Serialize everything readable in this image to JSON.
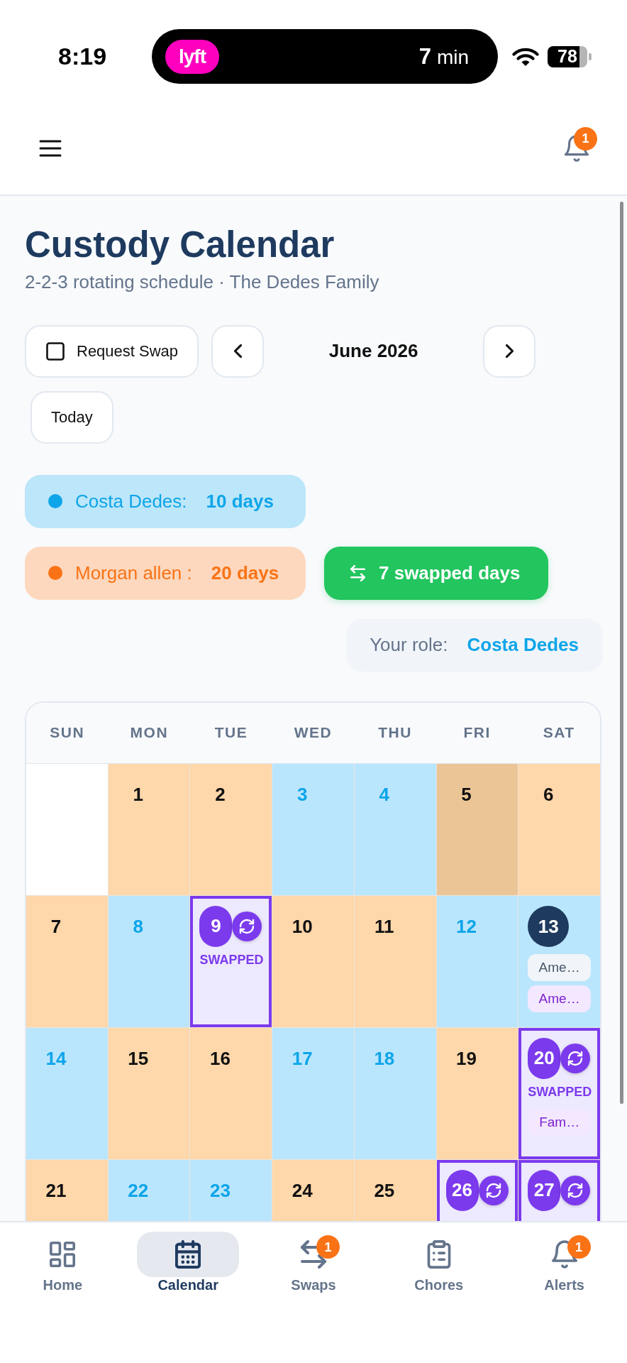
{
  "status_bar": {
    "time": "8:19",
    "live_activity": {
      "logo": "lyft",
      "eta_value": "7",
      "eta_unit": "min"
    },
    "battery": "78"
  },
  "header": {
    "notification_badge": "1"
  },
  "page": {
    "title": "Custody Calendar",
    "subtitle": "2-2-3 rotating schedule · The Dedes Family"
  },
  "toolbar": {
    "request_swap": {
      "label": "Request Swap",
      "checked": false
    },
    "month": "June 2026",
    "today_button": "Today"
  },
  "legend": [
    {
      "kind": "parent",
      "name": "Costa Dedes:",
      "count": "10 days",
      "color": "#0ea5e9"
    },
    {
      "kind": "parent",
      "name": "Morgan allen :",
      "count": "20 days",
      "color": "#f97316"
    },
    {
      "kind": "swaps",
      "label": "7 swapped days"
    }
  ],
  "role": {
    "label": "Your role:",
    "value": "Costa Dedes"
  },
  "calendar": {
    "weekdays": [
      "SUN",
      "MON",
      "TUE",
      "WED",
      "THU",
      "FRI",
      "SAT"
    ],
    "days": [
      {
        "kind": "blank",
        "today": false,
        "highlighted": false
      },
      {
        "date": "1",
        "kind": "morgan",
        "today": false,
        "highlighted": false
      },
      {
        "date": "2",
        "kind": "morgan",
        "today": false,
        "highlighted": false
      },
      {
        "date": "3",
        "kind": "costa",
        "today": false,
        "highlighted": false
      },
      {
        "date": "4",
        "kind": "costa",
        "today": false,
        "highlighted": false
      },
      {
        "date": "5",
        "kind": "morgan",
        "today": false,
        "highlighted": true
      },
      {
        "date": "6",
        "kind": "morgan",
        "today": false,
        "highlighted": false
      },
      {
        "date": "7",
        "kind": "morgan",
        "today": false,
        "highlighted": false
      },
      {
        "date": "8",
        "kind": "costa",
        "today": false,
        "highlighted": false
      },
      {
        "date": "9",
        "kind": "swapped",
        "today": false,
        "highlighted": false,
        "label": "SWAPPED"
      },
      {
        "date": "10",
        "kind": "morgan",
        "today": false,
        "highlighted": false
      },
      {
        "date": "11",
        "kind": "morgan",
        "today": false,
        "highlighted": false
      },
      {
        "date": "12",
        "kind": "costa",
        "today": false,
        "highlighted": false
      },
      {
        "date": "13",
        "kind": "costa",
        "today": true,
        "highlighted": false,
        "events": [
          {
            "kind": "general",
            "label": "Ame…"
          },
          {
            "kind": "swap",
            "label": "Ame…"
          }
        ]
      },
      {
        "date": "14",
        "kind": "costa",
        "today": false,
        "highlighted": false
      },
      {
        "date": "15",
        "kind": "morgan",
        "today": false,
        "highlighted": false
      },
      {
        "date": "16",
        "kind": "morgan",
        "today": false,
        "highlighted": false
      },
      {
        "date": "17",
        "kind": "costa",
        "today": false,
        "highlighted": false
      },
      {
        "date": "18",
        "kind": "costa",
        "today": false,
        "highlighted": false
      },
      {
        "date": "19",
        "kind": "morgan",
        "today": false,
        "highlighted": false
      },
      {
        "date": "20",
        "kind": "swapped",
        "today": false,
        "highlighted": false,
        "label": "SWAPPED",
        "events": [
          {
            "kind": "swap",
            "label": "Fam…"
          }
        ]
      },
      {
        "date": "21",
        "kind": "morgan",
        "today": false,
        "highlighted": false
      },
      {
        "date": "22",
        "kind": "costa",
        "today": false,
        "highlighted": false
      },
      {
        "date": "23",
        "kind": "costa",
        "today": false,
        "highlighted": false
      },
      {
        "date": "24",
        "kind": "morgan",
        "today": false,
        "highlighted": false
      },
      {
        "date": "25",
        "kind": "morgan",
        "today": false,
        "highlighted": false
      },
      {
        "date": "26",
        "kind": "swapped",
        "today": false,
        "highlighted": false
      },
      {
        "date": "27",
        "kind": "swapped",
        "today": false,
        "highlighted": false
      }
    ]
  },
  "bottom_nav": [
    {
      "kind": "home",
      "label": "Home",
      "selected": false
    },
    {
      "kind": "calendar",
      "label": "Calendar",
      "selected": true
    },
    {
      "kind": "swaps",
      "label": "Swaps",
      "selected": false,
      "badge": "1"
    },
    {
      "kind": "chores",
      "label": "Chores",
      "selected": false
    },
    {
      "kind": "alerts",
      "label": "Alerts",
      "selected": false,
      "badge": "1"
    }
  ]
}
